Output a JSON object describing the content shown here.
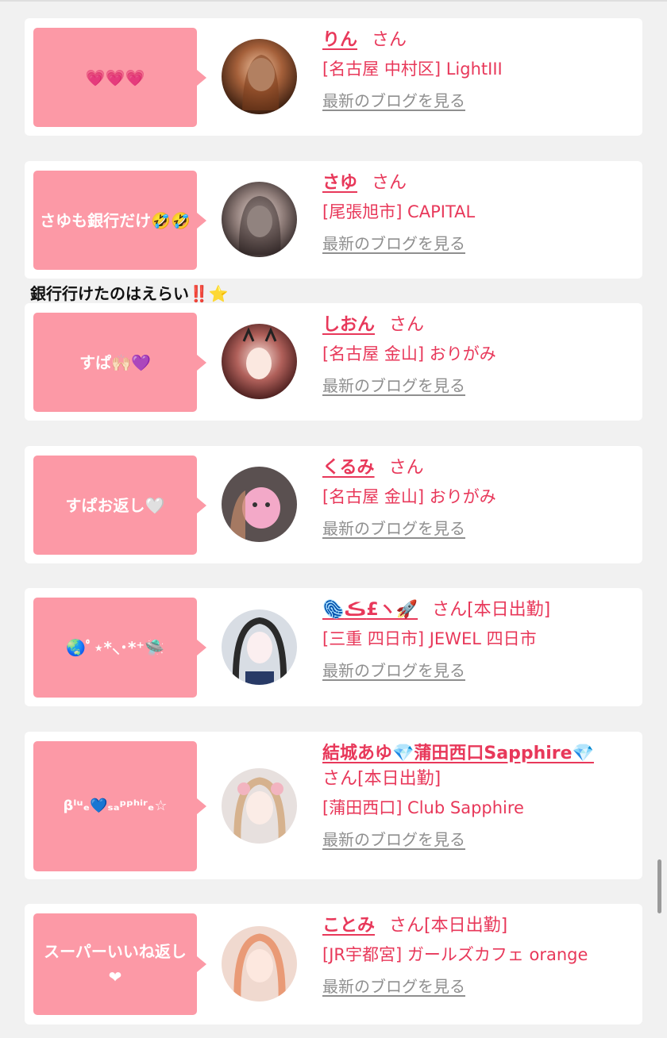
{
  "between_text": "銀行行けたのはえらい‼️⭐️",
  "cards": [
    {
      "bubble": "💗💗💗",
      "name": "りん",
      "suffix": "さん",
      "shop": "[名古屋 中村区] LightIII",
      "blog": "最新のブログを見る"
    },
    {
      "bubble": "さゆも銀行だけ🤣🤣",
      "name": "さゆ",
      "suffix": "さん",
      "shop": "[尾張旭市] CAPITAL",
      "blog": "最新のブログを見る"
    },
    {
      "bubble": "すぱ🙌🏻💜",
      "name": "しおん",
      "suffix": "さん",
      "shop": "[名古屋 金山] おりがみ",
      "blog": "最新のブログを見る"
    },
    {
      "bubble": "すぱお返し🤍",
      "name": "くるみ",
      "suffix": "さん",
      "shop": "[名古屋 金山] おりがみ",
      "blog": "最新のブログを見る"
    },
    {
      "bubble": "🌏ﾟ⋆*⸜･*⁺🛸",
      "name": "🫆ڪ£ヽ🚀",
      "suffix": "さん[本日出勤]",
      "shop": "[三重 四日市] JEWEL 四日市",
      "blog": "最新のブログを見る"
    },
    {
      "bubble": "βˡᵘₑ💙ₛₐᵖᵖʰⁱʳₑ☆",
      "name": "結城あゆ💎蒲田西口Sapphire💎",
      "suffix": "さん[本日出勤]",
      "shop": "[蒲田西口] Club Sapphire",
      "blog": "最新のブログを見る"
    },
    {
      "bubble": "スーパーいいね返し❤︎",
      "name": "ことみ",
      "suffix": "さん[本日出勤]",
      "shop": "[JR宇都宮] ガールズカフェ orange",
      "blog": "最新のブログを見る"
    }
  ],
  "colors": {
    "bubble": "#fc99a6",
    "name": "#e8385a",
    "link": "#8f8f8f",
    "background": "#f1f1f1"
  }
}
